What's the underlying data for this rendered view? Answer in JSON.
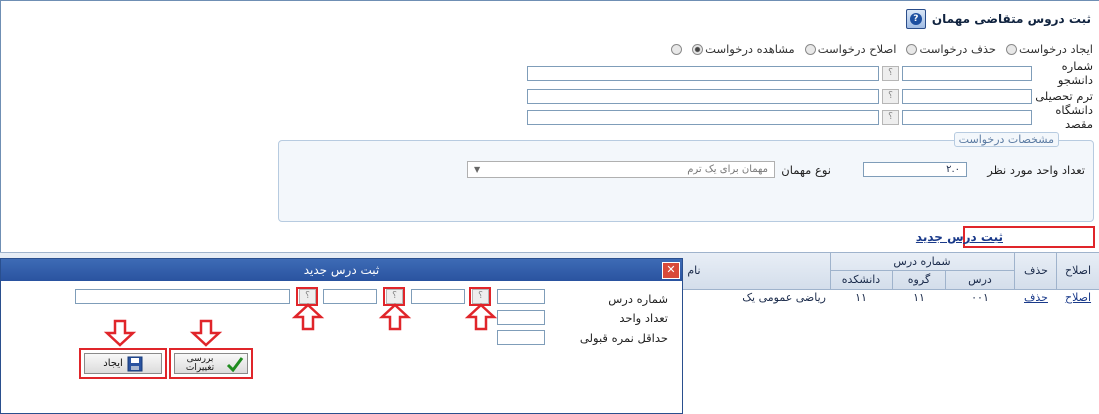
{
  "page": {
    "title": "ثبت دروس متقاضی مهمان"
  },
  "mode_options": [
    {
      "label": "ایجاد درخواست",
      "selected": false
    },
    {
      "label": "حذف درخواست",
      "selected": false
    },
    {
      "label": "اصلاح درخواست",
      "selected": false
    },
    {
      "label": "مشاهده درخواست",
      "selected": true
    }
  ],
  "form": {
    "student_number": {
      "label": "شماره دانشجو",
      "value": ""
    },
    "term": {
      "label": "ترم تحصیلی",
      "value": ""
    },
    "destination_university": {
      "label": "دانشگاه مقصد",
      "value": ""
    }
  },
  "request_details": {
    "legend": "مشخصات درخواست",
    "units_label": "تعداد واحد مورد نظر",
    "units_value": "۲.۰",
    "guest_type_label": "نوع مهمان",
    "guest_type_value": "مهمان برای یک ترم"
  },
  "new_course_link": "ثبت درس جدید",
  "table": {
    "headers": {
      "edit": "اصلاح",
      "delete": "حذف",
      "course_number": "شماره درس",
      "course": "درس",
      "group": "گروه",
      "faculty": "دانشکده",
      "name": "نام"
    },
    "rows": [
      {
        "edit": "اصلاح",
        "delete": "حذف",
        "course": "۰۰۱",
        "group": "۱۱",
        "faculty": "۱۱",
        "name": "ریاضی عمومی یک"
      }
    ]
  },
  "dialog": {
    "title": "ثبت درس جدید",
    "close_symbol": "✕",
    "course_number_label": "شماره درس",
    "units_label": "تعداد واحد",
    "min_grade_label": "حداقل نمره قبولی",
    "check_button": "بررسی تغییرات",
    "create_button": "ایجاد",
    "lookup_symbol": "؟"
  },
  "colors": {
    "highlight": "#e0252a",
    "accent": "#2a53a0"
  }
}
